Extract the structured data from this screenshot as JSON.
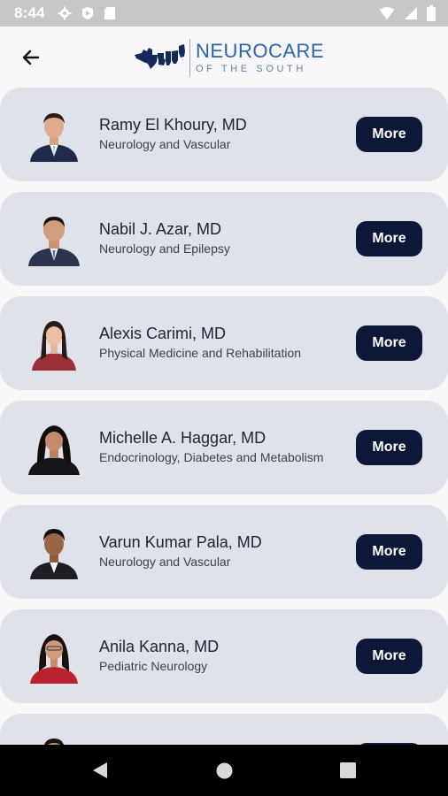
{
  "status_bar": {
    "time": "8:44",
    "left_icons": [
      "gear-icon",
      "shield-icon",
      "sd-card-icon"
    ],
    "right_icons": [
      "wifi-icon",
      "signal-icon",
      "battery-icon"
    ]
  },
  "header": {
    "back_icon": "arrow-left-icon",
    "logo": {
      "name_part1": "NEURO",
      "name_part2": "CARE",
      "subtitle": "OF THE SOUTH"
    }
  },
  "doctors": [
    {
      "name": "Ramy El Khoury, MD",
      "specialty": "Neurology and Vascular",
      "button": "More"
    },
    {
      "name": "Nabil J. Azar, MD",
      "specialty": "Neurology and Epilepsy",
      "button": "More"
    },
    {
      "name": "Alexis Carimi, MD",
      "specialty": "Physical Medicine and Rehabilitation",
      "button": "More"
    },
    {
      "name": "Michelle A. Haggar, MD",
      "specialty": "Endocrinology, Diabetes and Metabolism",
      "button": "More"
    },
    {
      "name": "Varun Kumar Pala, MD",
      "specialty": "Neurology and Vascular",
      "button": "More"
    },
    {
      "name": "Anila Kanna, MD",
      "specialty": "Pediatric Neurology",
      "button": "More"
    },
    {
      "name": "",
      "specialty": "",
      "button": ""
    }
  ],
  "colors": {
    "card_background": "#e0e2eb",
    "button_background": "#0d1738",
    "logo_blue": "#2b64a8",
    "status_bar": "#c7c7c7"
  },
  "nav_bar": {
    "icons": [
      "nav-back-icon",
      "nav-home-icon",
      "nav-recents-icon"
    ]
  }
}
